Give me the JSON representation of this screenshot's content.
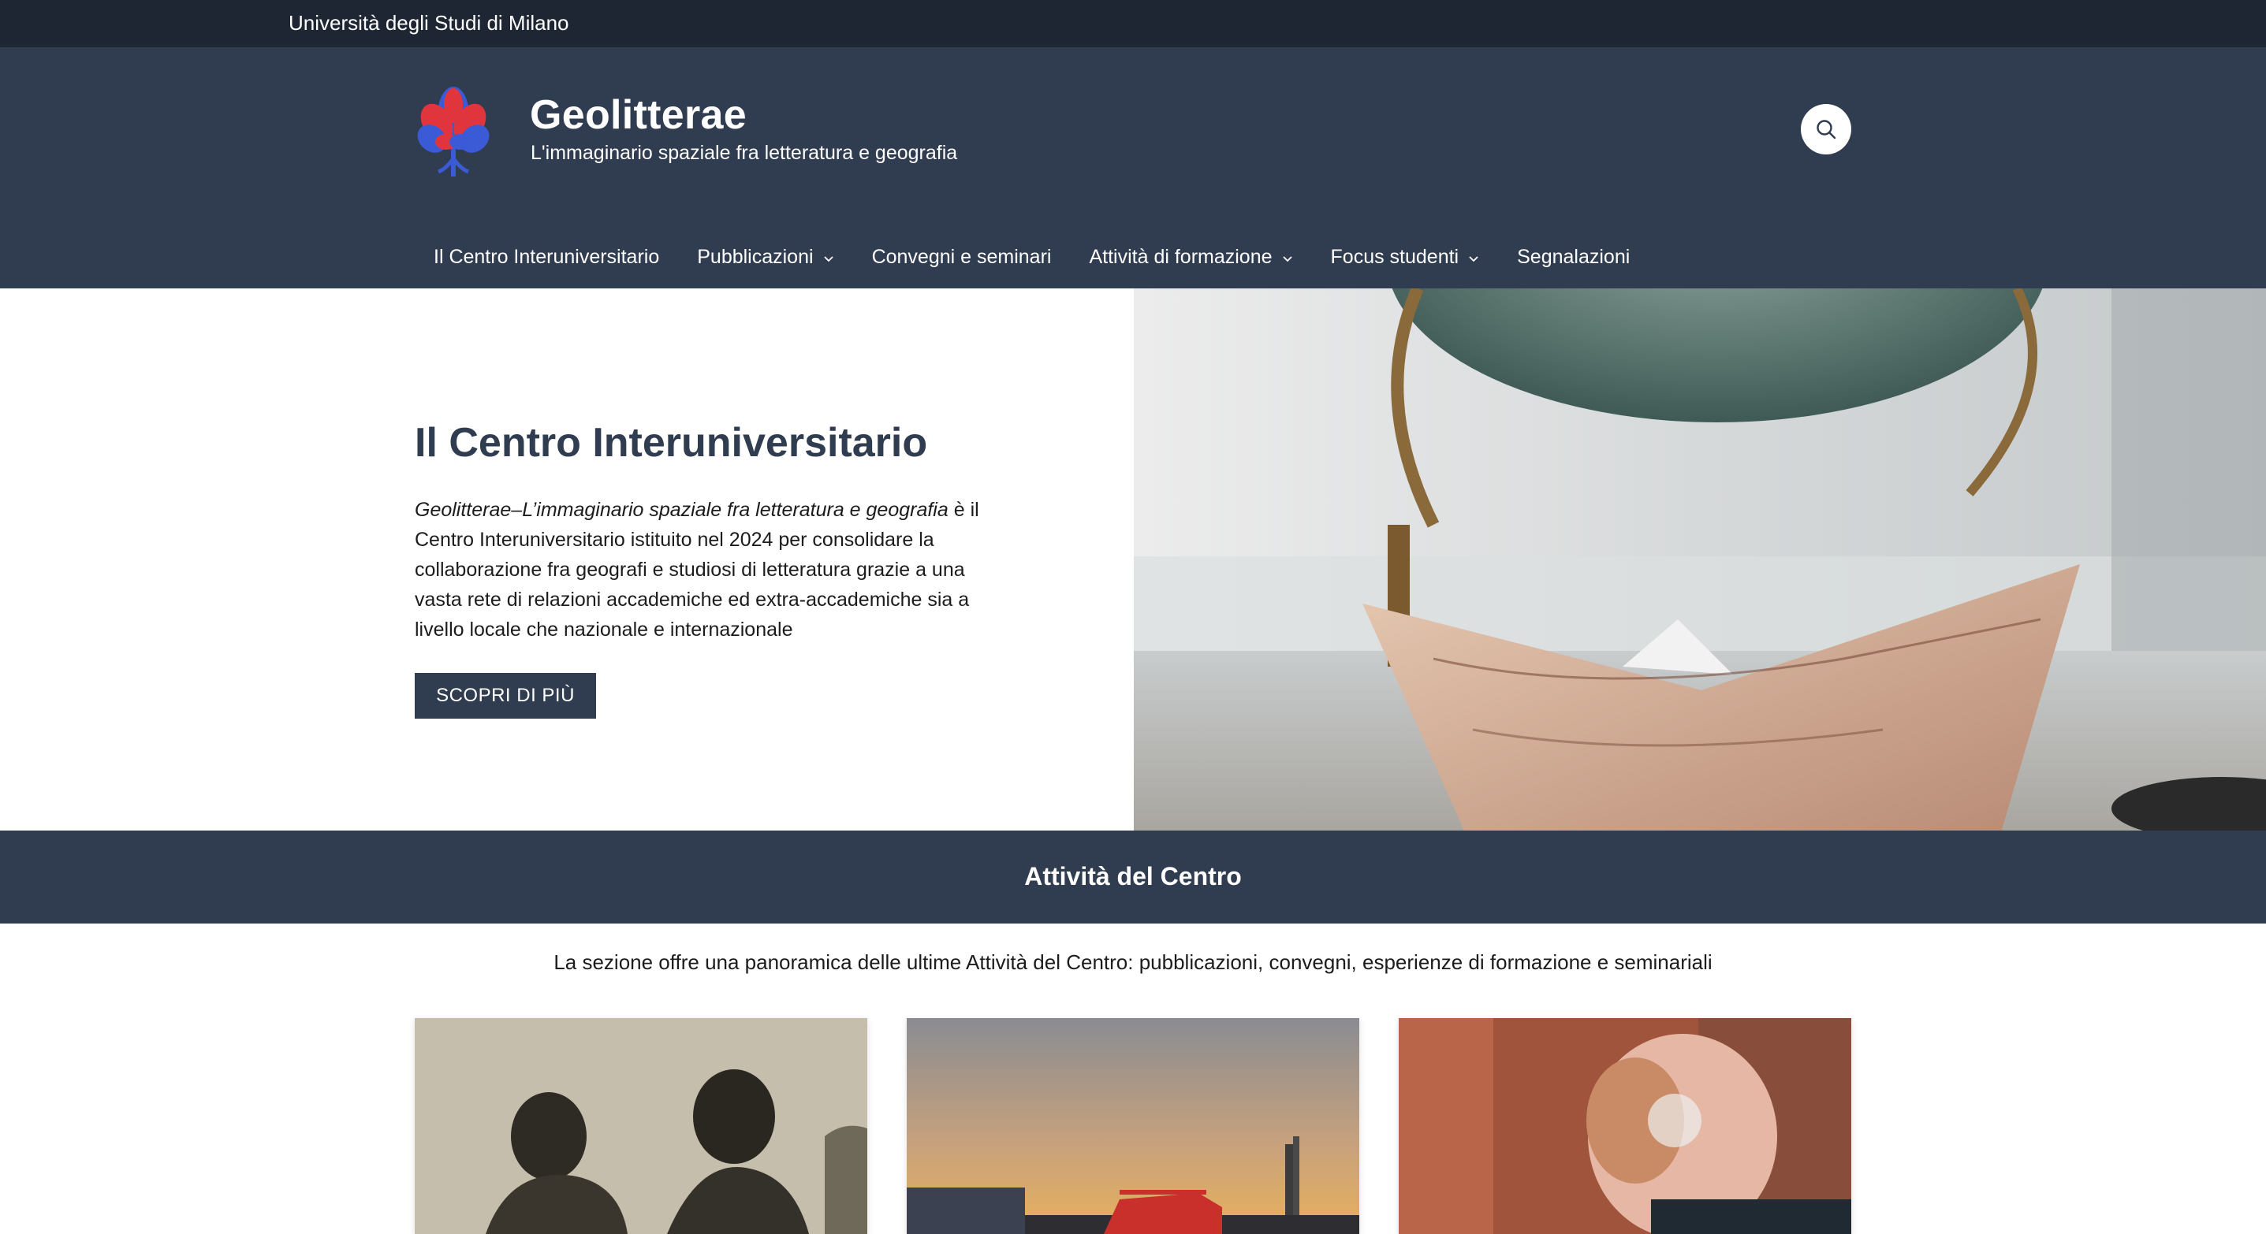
{
  "topbar": {
    "university": "Università degli Studi di Milano"
  },
  "header": {
    "title": "Geolitterae",
    "subtitle": "L'immaginario spaziale fra letteratura e geografia",
    "logo_icon": "tree-logo-icon",
    "search_icon": "search-icon"
  },
  "nav": {
    "items": [
      {
        "label": "Il Centro Interuniversitario",
        "has_dropdown": false
      },
      {
        "label": "Pubblicazioni",
        "has_dropdown": true
      },
      {
        "label": "Convegni e seminari",
        "has_dropdown": false
      },
      {
        "label": "Attività di formazione",
        "has_dropdown": true
      },
      {
        "label": "Focus studenti",
        "has_dropdown": true
      },
      {
        "label": "Segnalazioni",
        "has_dropdown": false
      }
    ]
  },
  "hero": {
    "title": "Il Centro Interuniversitario",
    "text_italic": "Geolitterae–L’immaginario spaziale fra letteratura e geografia",
    "text_rest": " è il Centro Interuniversitario istituito nel 2024 per consolidare la collaborazione fra geografi e studiosi di letteratura grazie a una vasta rete di relazioni accademiche ed extra-accademiche sia a livello locale che nazionale e internazionale",
    "button": "SCOPRI DI PIÙ"
  },
  "activities": {
    "heading": "Attività del Centro",
    "intro": "La sezione offre una panoramica delle ultime Attività del Centro: pubblicazioni, convegni, esperienze di formazione e seminariali"
  },
  "colors": {
    "topbar": "#1e2633",
    "header": "#303c4f",
    "accent": "#303c4f",
    "logo_red": "#e0353c",
    "logo_blue": "#3b5bd6"
  }
}
